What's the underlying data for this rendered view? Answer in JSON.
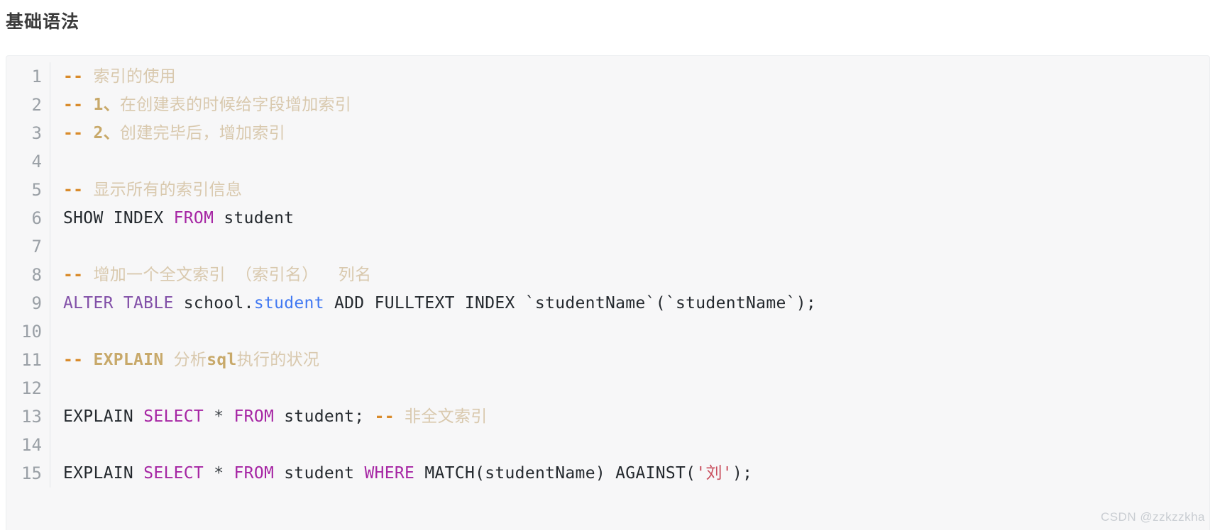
{
  "page": {
    "title": "基础语法",
    "watermark": "CSDN @zzkzzkha"
  },
  "code_block": {
    "language": "sql",
    "background": "#f7f7f8",
    "gutter_color": "#9aa0a6",
    "line_numbers": [
      "1",
      "2",
      "3",
      "4",
      "5",
      "6",
      "7",
      "8",
      "9",
      "10",
      "11",
      "12",
      "13",
      "14",
      "15"
    ],
    "lines": [
      {
        "number": "1",
        "text": "-- 索引的使用",
        "tokens": [
          {
            "cls": "t-cmt-mark",
            "text": "--"
          },
          {
            "cls": "t-cmt",
            "text": " 索引的使用"
          }
        ]
      },
      {
        "number": "2",
        "text": "-- 1、在创建表的时候给字段增加索引",
        "tokens": [
          {
            "cls": "t-cmt-mark",
            "text": "--"
          },
          {
            "cls": "t-cmt-em",
            "text": " 1、"
          },
          {
            "cls": "t-cmt",
            "text": "在创建表的时候给字段增加索引"
          }
        ]
      },
      {
        "number": "3",
        "text": "-- 2、创建完毕后，增加索引",
        "tokens": [
          {
            "cls": "t-cmt-mark",
            "text": "--"
          },
          {
            "cls": "t-cmt-em",
            "text": " 2、"
          },
          {
            "cls": "t-cmt",
            "text": "创建完毕后，增加索引"
          }
        ]
      },
      {
        "number": "4",
        "text": "",
        "tokens": []
      },
      {
        "number": "5",
        "text": "-- 显示所有的索引信息",
        "tokens": [
          {
            "cls": "t-cmt-mark",
            "text": "--"
          },
          {
            "cls": "t-cmt",
            "text": " 显示所有的索引信息"
          }
        ]
      },
      {
        "number": "6",
        "text": "SHOW INDEX FROM student",
        "tokens": [
          {
            "cls": "t-plain",
            "text": "SHOW INDEX "
          },
          {
            "cls": "t-kw",
            "text": "FROM"
          },
          {
            "cls": "t-plain",
            "text": " student"
          }
        ]
      },
      {
        "number": "7",
        "text": "",
        "tokens": []
      },
      {
        "number": "8",
        "text": "-- 增加一个全文索引 （索引名） 列名",
        "tokens": [
          {
            "cls": "t-cmt-mark",
            "text": "--"
          },
          {
            "cls": "t-cmt",
            "text": " 增加一个全文索引 （索引名）  列名"
          }
        ]
      },
      {
        "number": "9",
        "text": "ALTER TABLE school.student ADD FULLTEXT INDEX `studentName`(`studentName`);",
        "tokens": [
          {
            "cls": "t-kw2",
            "text": "ALTER TABLE"
          },
          {
            "cls": "t-plain",
            "text": " school."
          },
          {
            "cls": "t-ident",
            "text": "student"
          },
          {
            "cls": "t-plain",
            "text": " ADD FULLTEXT INDEX `studentName`(`studentName`);"
          }
        ]
      },
      {
        "number": "10",
        "text": "",
        "tokens": []
      },
      {
        "number": "11",
        "text": "-- EXPLAIN 分析sql执行的状况",
        "tokens": [
          {
            "cls": "t-cmt-mark",
            "text": "--"
          },
          {
            "cls": "t-cmt-em",
            "text": " EXPLAIN "
          },
          {
            "cls": "t-cmt",
            "text": "分析"
          },
          {
            "cls": "t-cmt-em",
            "text": "sql"
          },
          {
            "cls": "t-cmt",
            "text": "执行的状况"
          }
        ]
      },
      {
        "number": "12",
        "text": "",
        "tokens": []
      },
      {
        "number": "13",
        "text": "EXPLAIN SELECT * FROM student; -- 非全文索引",
        "tokens": [
          {
            "cls": "t-plain",
            "text": "EXPLAIN "
          },
          {
            "cls": "t-kw",
            "text": "SELECT"
          },
          {
            "cls": "t-op",
            "text": " * "
          },
          {
            "cls": "t-kw",
            "text": "FROM"
          },
          {
            "cls": "t-plain",
            "text": " student; "
          },
          {
            "cls": "t-cmt-mark",
            "text": "--"
          },
          {
            "cls": "t-cmt",
            "text": " 非全文索引"
          }
        ]
      },
      {
        "number": "14",
        "text": "",
        "tokens": []
      },
      {
        "number": "15",
        "text": "EXPLAIN SELECT * FROM student WHERE MATCH(studentName) AGAINST('刘');",
        "tokens": [
          {
            "cls": "t-plain",
            "text": "EXPLAIN "
          },
          {
            "cls": "t-kw",
            "text": "SELECT"
          },
          {
            "cls": "t-op",
            "text": " * "
          },
          {
            "cls": "t-kw",
            "text": "FROM"
          },
          {
            "cls": "t-plain",
            "text": " student "
          },
          {
            "cls": "t-kw",
            "text": "WHERE"
          },
          {
            "cls": "t-plain",
            "text": " MATCH(studentName) AGAINST("
          },
          {
            "cls": "t-str",
            "text": "'刘'"
          },
          {
            "cls": "t-plain",
            "text": ");"
          }
        ]
      }
    ]
  }
}
